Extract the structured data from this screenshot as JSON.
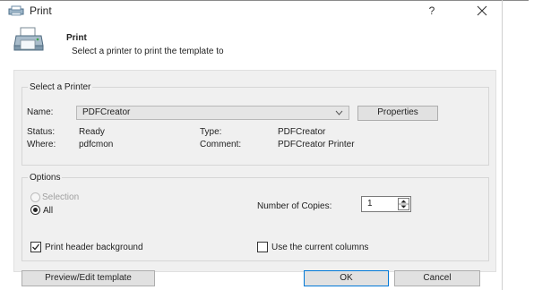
{
  "window": {
    "title": "Print",
    "help_label": "?"
  },
  "header": {
    "title": "Print",
    "subtitle": "Select a printer to print the template to"
  },
  "printer_group": {
    "legend": "Select a Printer",
    "name_label": "Name:",
    "name_value": "PDFCreator",
    "properties_label": "Properties",
    "status_label": "Status:",
    "status_value": "Ready",
    "where_label": "Where:",
    "where_value": "pdfcmon",
    "type_label": "Type:",
    "type_value": "PDFCreator",
    "comment_label": "Comment:",
    "comment_value": "PDFCreator Printer"
  },
  "options_group": {
    "legend": "Options",
    "selection_label": "Selection",
    "selection_enabled": false,
    "all_label": "All",
    "all_selected": true,
    "copies_label": "Number of Copies:",
    "copies_value": "1",
    "print_header_label": "Print header background",
    "print_header_checked": true,
    "use_columns_label": "Use the current columns",
    "use_columns_checked": false
  },
  "buttons": {
    "preview_label": "Preview/Edit template",
    "ok_label": "OK",
    "cancel_label": "Cancel"
  },
  "colors": {
    "panel_bg": "#f0f0f0",
    "accent_border": "#0078d7",
    "disabled_text": "#a0a0a0"
  }
}
